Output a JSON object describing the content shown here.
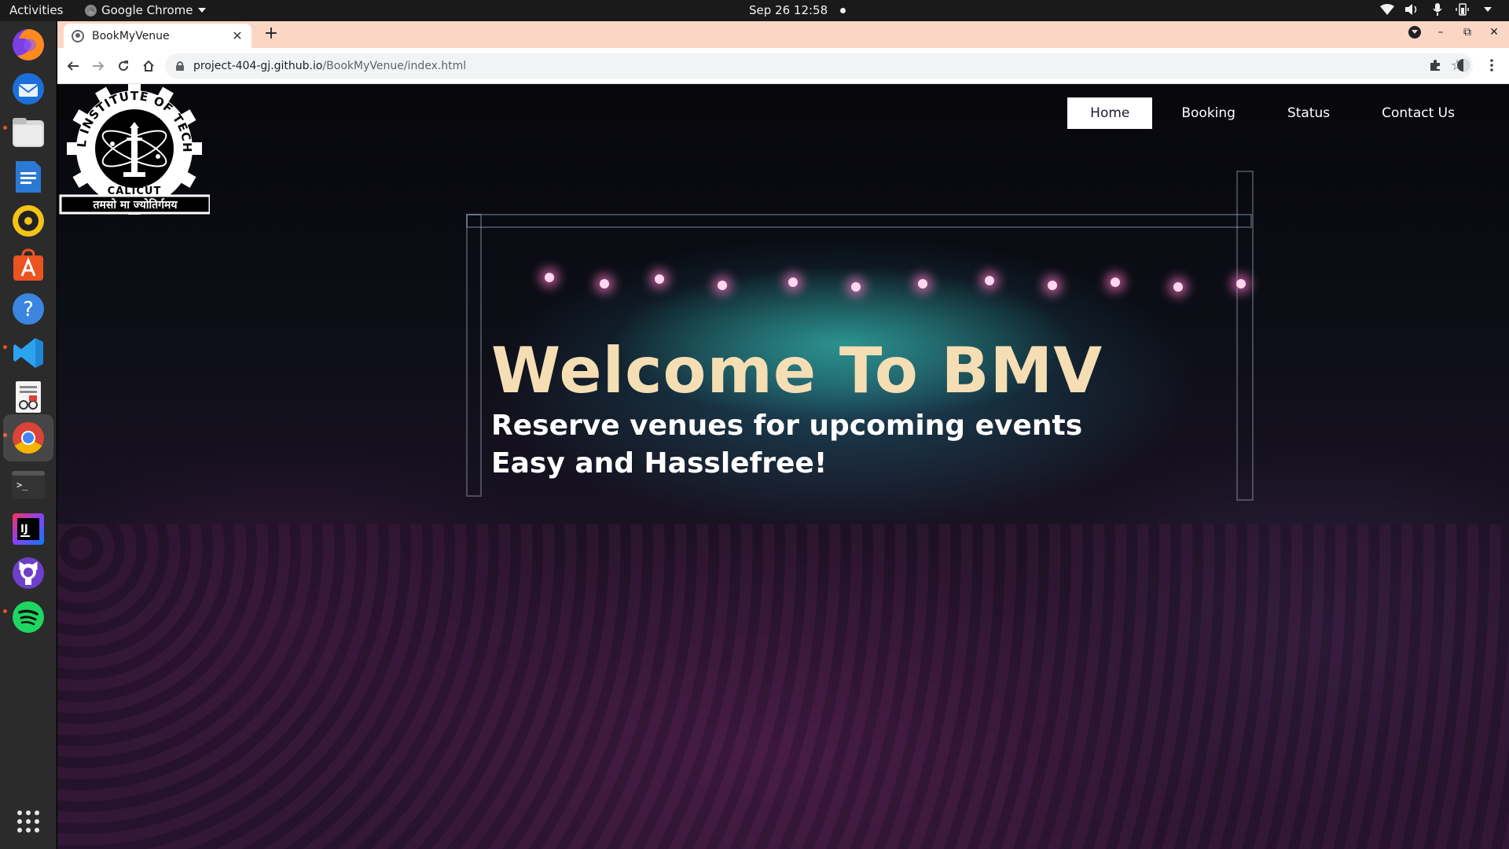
{
  "topbar": {
    "activities": "Activities",
    "app_name": "Google Chrome",
    "datetime": "Sep 26  12:58"
  },
  "dock": {
    "apps": [
      "firefox-icon",
      "thunderbird-icon",
      "files-icon",
      "writer-icon",
      "rhythmbox-icon",
      "software-center-icon",
      "help-icon",
      "vscode-icon",
      "document-viewer-icon",
      "chrome-icon",
      "terminal-icon",
      "intellij-icon",
      "github-desktop-icon",
      "spotify-icon"
    ]
  },
  "browser": {
    "tab_title": "BookMyVenue",
    "url_host": "project-404-gj.github.io",
    "url_path": "/BookMyVenue/index.html"
  },
  "page": {
    "nav": [
      "Home",
      "Booking",
      "Status",
      "Contact Us"
    ],
    "logo_text_top": "NATIONAL INSTITUTE OF TECHNOLOGY",
    "logo_text_bottom": "CALICUT",
    "logo_motto": "तमसो मा ज्योतिर्गमय",
    "hero_title": "Welcome To BMV",
    "hero_line1": "Reserve venues for upcoming events",
    "hero_line2": "Easy and Hasslefree!"
  },
  "colors": {
    "hero_title": "#f5deb3",
    "tabstrip": "#fad7c4",
    "accent_dock_dot": "#e95420"
  }
}
